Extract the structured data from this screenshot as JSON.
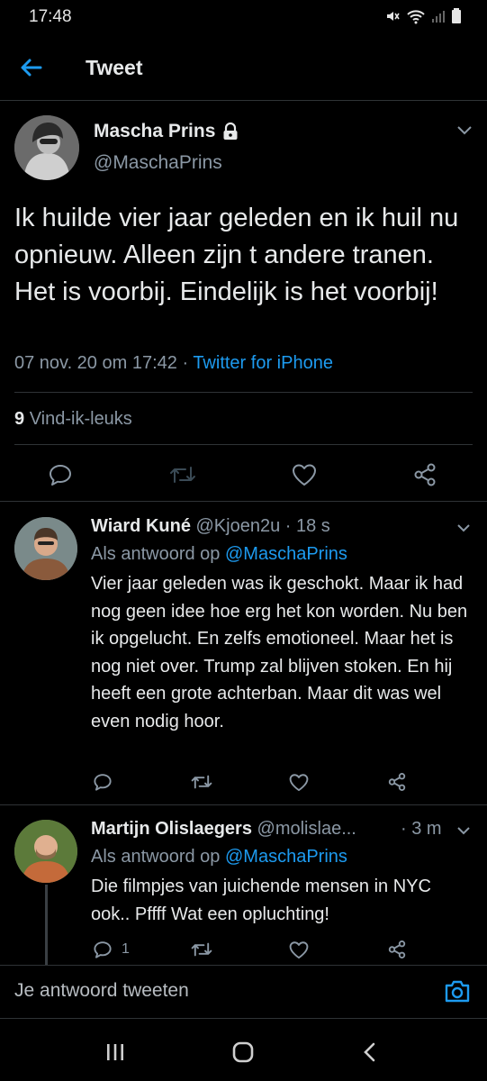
{
  "status_bar": {
    "time": "17:48"
  },
  "header": {
    "title": "Tweet"
  },
  "main_tweet": {
    "author_name": "Mascha Prins",
    "handle": "@MaschaPrins",
    "text": "Ik huilde vier jaar geleden en ik huil nu opnieuw. Alleen zijn t andere tranen. Het is voorbij. Eindelijk is het voorbij!",
    "timestamp": "07 nov. 20 om 17:42",
    "separator": "·",
    "source": "Twitter for iPhone",
    "likes_count": "9",
    "likes_label": "Vind-ik-leuks"
  },
  "replies": [
    {
      "name": "Wiard Kuné",
      "handle": "@Kjoen2u",
      "time": "· 18 s",
      "reply_to_label": "Als antwoord op",
      "reply_to_handle": "@MaschaPrins",
      "text": "Vier jaar geleden was ik geschokt. Maar ik had nog geen idee hoe erg het kon worden. Nu ben ik opgelucht. En zelfs emotioneel. Maar het is nog niet over. Trump zal blijven stoken. En hij heeft een grote achterban. Maar dit was wel even nodig hoor.",
      "reply_count": ""
    },
    {
      "name": "Martijn Olislaegers",
      "handle": "@molislae...",
      "time": "· 3 m",
      "reply_to_label": "Als antwoord op",
      "reply_to_handle": "@MaschaPrins",
      "text": "Die filmpjes van juichende mensen in NYC ook.. Pffff Wat een opluchting!",
      "reply_count": "1"
    }
  ],
  "compose": {
    "placeholder": "Je antwoord tweeten"
  },
  "colors": {
    "accent": "#1d9bf0",
    "background": "#000000",
    "muted": "#8b98a5",
    "divider": "#2f3336"
  },
  "icons": {
    "back": "arrow-left-icon",
    "lock": "lock-icon",
    "chevron": "chevron-down-icon",
    "reply": "speech-bubble-icon",
    "retweet": "retweet-icon",
    "like": "heart-icon",
    "share": "share-icon",
    "camera": "camera-icon"
  }
}
